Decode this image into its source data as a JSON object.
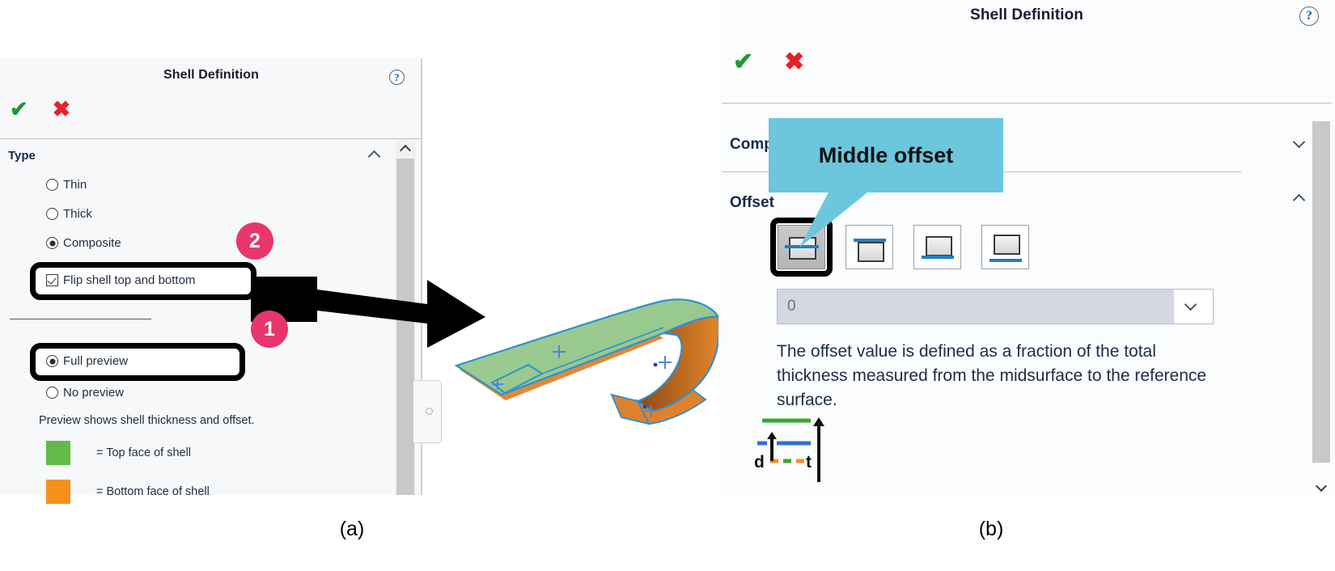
{
  "figure": {
    "label_a": "(a)",
    "label_b": "(b)"
  },
  "colors": {
    "badge_pink": "#e8356d",
    "callout_cyan": "#6cc6dc",
    "top_face_green": "#63bb47",
    "bottom_face_orange": "#f5901e",
    "accept_green": "#1f9b35",
    "cancel_red": "#e8202a",
    "offset_blue": "#1f7fc0"
  },
  "panel_a": {
    "title": "Shell Definition",
    "help_icon": "question-mark-icon",
    "accept_icon": "check-icon",
    "cancel_icon": "cross-icon",
    "section": {
      "label": "Type",
      "collapse_icon": "chevron-up-icon"
    },
    "type_options": [
      {
        "label": "Thin",
        "selected": false
      },
      {
        "label": "Thick",
        "selected": false
      },
      {
        "label": "Composite",
        "selected": true
      }
    ],
    "flip_checkbox": {
      "label": "Flip shell top and bottom",
      "checked": true
    },
    "preview_options": [
      {
        "label": "Full preview",
        "selected": true
      },
      {
        "label": "No preview",
        "selected": false
      }
    ],
    "preview_note": "Preview shows shell thickness and offset.",
    "legend": [
      {
        "swatch": "#63bb47",
        "text": "= Top face of shell"
      },
      {
        "swatch": "#f5901e",
        "text": "= Bottom face of shell"
      }
    ],
    "callouts": [
      {
        "number": "1",
        "target": "Full preview"
      },
      {
        "number": "2",
        "target": "Flip shell top and bottom"
      }
    ],
    "scrollbar": {
      "up_icon": "chevron-up-icon",
      "down_icon": "chevron-down-icon"
    }
  },
  "panel_b": {
    "title": "Shell Definition",
    "help_icon": "question-mark-icon",
    "accept_icon": "check-icon",
    "cancel_icon": "cross-icon",
    "sections": [
      {
        "label": "Composite",
        "state_icon": "chevron-down-icon",
        "expanded": false
      },
      {
        "label": "Offset",
        "state_icon": "chevron-up-icon",
        "expanded": true
      }
    ],
    "offset_buttons": [
      {
        "name": "middle-offset",
        "selected": true
      },
      {
        "name": "top-offset",
        "selected": false
      },
      {
        "name": "bottom-offset",
        "selected": false
      },
      {
        "name": "custom-offset",
        "selected": false
      }
    ],
    "offset_value": "0",
    "offset_value_dropdown_icon": "chevron-down-icon",
    "description": "The offset value is defined as a fraction of the total thickness measured from the midsurface to the reference surface.",
    "diagram": {
      "label_d": "d",
      "label_t": "t",
      "top_line_color": "#3aa832",
      "ref_line_color": "#2e6fd0",
      "bottom_line_color": "#f5901e"
    },
    "tooltip": {
      "text": "Middle offset"
    },
    "scrollbar": {
      "down_icon": "chevron-down-icon"
    }
  }
}
